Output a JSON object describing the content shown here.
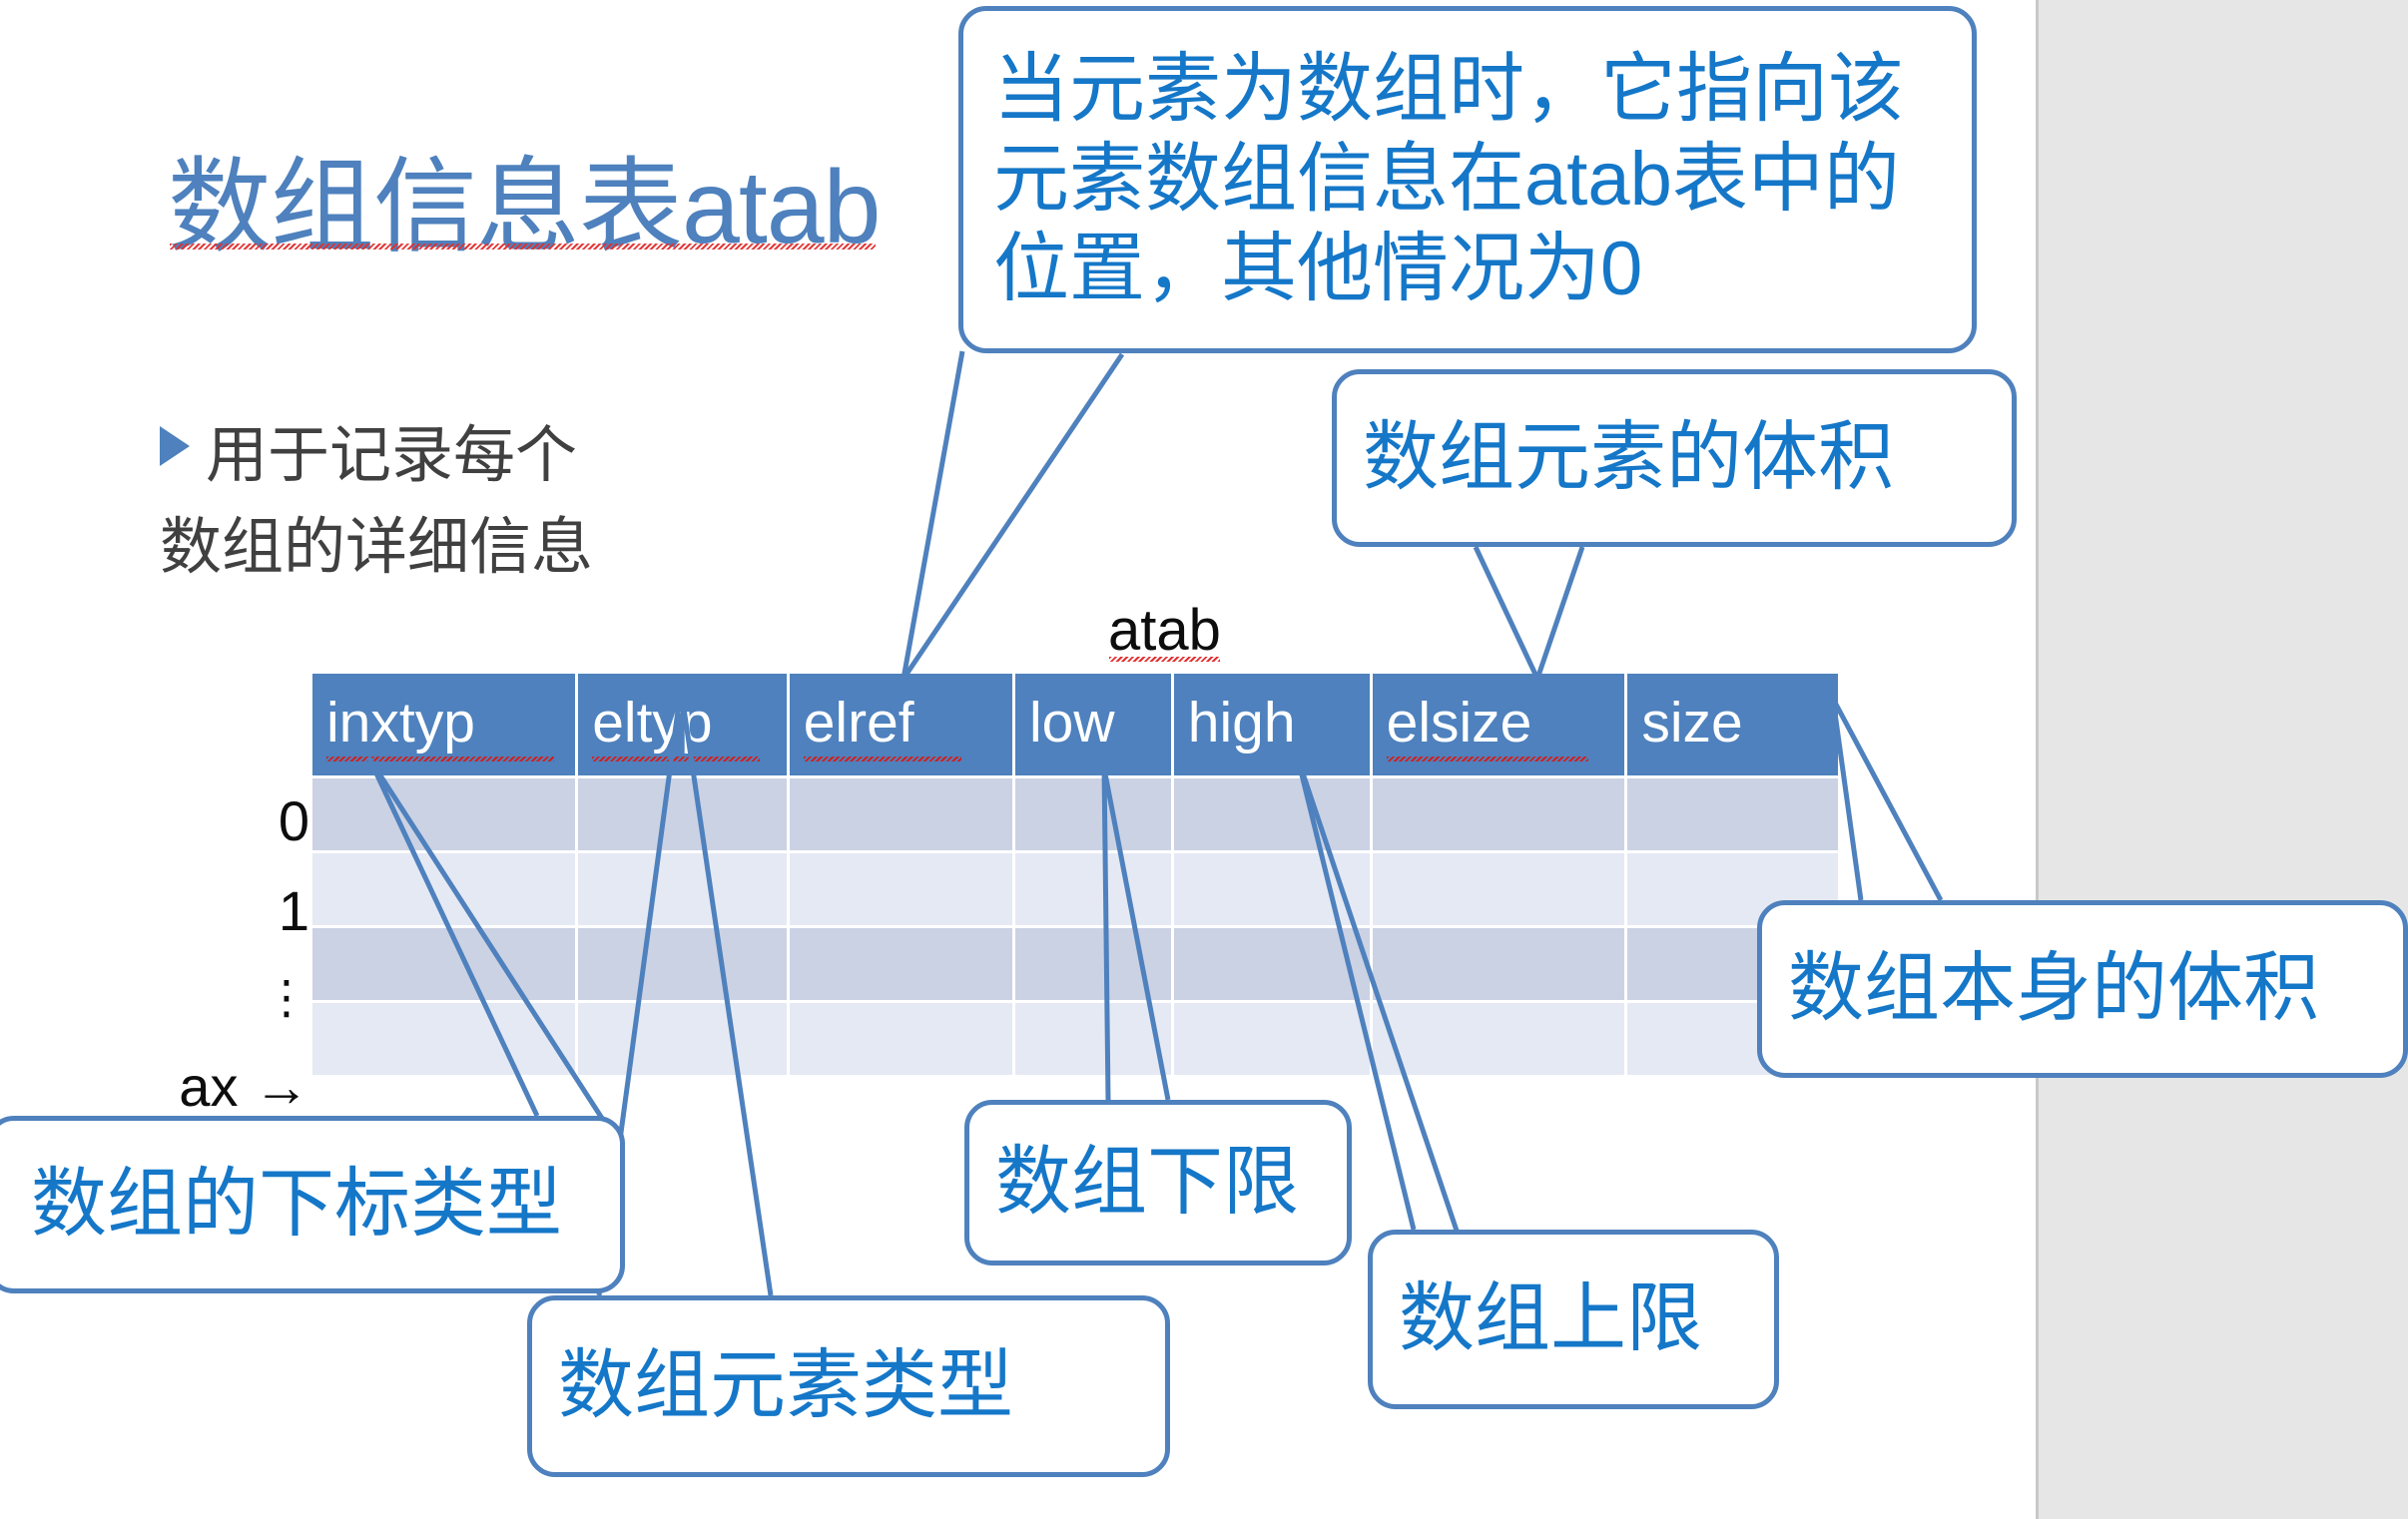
{
  "slide": {
    "title": "数组信息表atab",
    "bullet": {
      "marker": "triangle-bullet",
      "line1": "用于记录每个",
      "line2": "数组的详细信息"
    },
    "table_caption": "atab"
  },
  "table": {
    "columns": [
      "inxtyp",
      "eltyp",
      "elref",
      "low",
      "high",
      "elsize",
      "size"
    ],
    "row_labels": [
      "0",
      "1",
      "⋮",
      "ax →"
    ],
    "rows": [
      [
        "",
        "",
        "",
        "",
        "",
        "",
        ""
      ],
      [
        "",
        "",
        "",
        "",
        "",
        "",
        ""
      ],
      [
        "",
        "",
        "",
        "",
        "",
        "",
        ""
      ],
      [
        "",
        "",
        "",
        "",
        "",
        "",
        ""
      ]
    ]
  },
  "callouts": {
    "elref": "当元素为数组时，它指向该元素数组信息在atab表中的位置，其他情况为0",
    "elsize": "数组元素的体积",
    "size": "数组本身的体积",
    "inxtyp": "数组的下标类型",
    "eltyp": "数组元素类型",
    "low": "数组下限",
    "high": "数组上限"
  },
  "colors": {
    "accent_blue": "#4E81BD",
    "callout_text": "#1577C8",
    "header_fill": "#4E81BD",
    "row_dark": "#CBD2E4",
    "row_light": "#E5E9F4",
    "body_text": "#404040",
    "canvas_background": "#E6E6E6",
    "slide_background": "#FFFFFF",
    "spellcheck_underline": "#E03030"
  }
}
